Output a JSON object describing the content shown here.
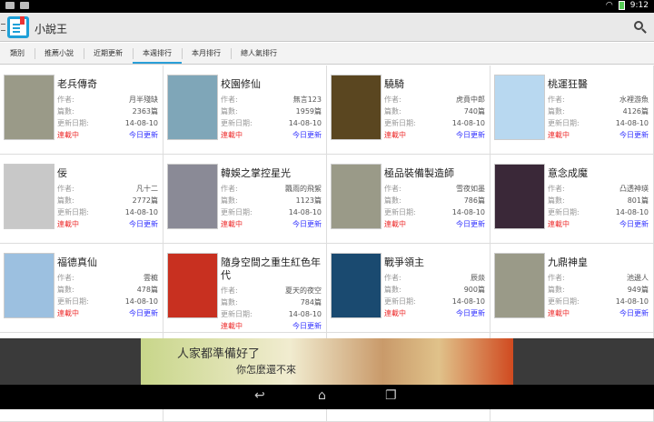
{
  "status": {
    "time": "9:12"
  },
  "app": {
    "title": "小說王"
  },
  "tabs": [
    "類別",
    "推薦小說",
    "近期更新",
    "本週排行",
    "本月排行",
    "總人氣排行"
  ],
  "labels": {
    "author": "作者:",
    "chapters": "篇數:",
    "updated": "更新日期:"
  },
  "books": [
    {
      "title": "老兵傳奇",
      "author": "月半殘缺",
      "chapters": "2363篇",
      "date": "14-08-10",
      "status": "連載中",
      "update": "今日更新",
      "cover": "#9a9a88"
    },
    {
      "title": "校園修仙",
      "author": "無言123",
      "chapters": "1959篇",
      "date": "14-08-10",
      "status": "連載中",
      "update": "今日更新",
      "cover": "#7fa6b8"
    },
    {
      "title": "驍騎",
      "author": "虎賁中郎",
      "chapters": "740篇",
      "date": "14-08-10",
      "status": "連載中",
      "update": "今日更新",
      "cover": "#5a4620"
    },
    {
      "title": "桃運狂醫",
      "author": "水裡游魚",
      "chapters": "4126篇",
      "date": "14-08-10",
      "status": "連載中",
      "update": "今日更新",
      "cover": "#b8d8f0"
    },
    {
      "title": "佞",
      "author": "凡十二",
      "chapters": "2772篇",
      "date": "14-08-10",
      "status": "連載中",
      "update": "今日更新",
      "cover": "#c8c8c8"
    },
    {
      "title": "韓娛之掌控星光",
      "author": "飄雨的飛絮",
      "chapters": "1123篇",
      "date": "14-08-10",
      "status": "連載中",
      "update": "今日更新",
      "cover": "#8a8a96"
    },
    {
      "title": "極品裝備製造師",
      "author": "雪夜如墨",
      "chapters": "786篇",
      "date": "14-08-10",
      "status": "連載中",
      "update": "今日更新",
      "cover": "#9a9a88"
    },
    {
      "title": "意念成魔",
      "author": "凸透神瑛",
      "chapters": "801篇",
      "date": "14-08-10",
      "status": "連載中",
      "update": "今日更新",
      "cover": "#3a2838"
    },
    {
      "title": "福德真仙",
      "author": "雲榳",
      "chapters": "478篇",
      "date": "14-08-10",
      "status": "連載中",
      "update": "今日更新",
      "cover": "#9cc0e0"
    },
    {
      "title": "隨身空間之重生紅色年代",
      "author": "夏天的夜空",
      "chapters": "784篇",
      "date": "14-08-10",
      "status": "連載中",
      "update": "今日更新",
      "cover": "#c83020"
    },
    {
      "title": "戰爭領主",
      "author": "辰燚",
      "chapters": "900篇",
      "date": "14-08-10",
      "status": "連載中",
      "update": "今日更新",
      "cover": "#1a4a70"
    },
    {
      "title": "九鼎神皇",
      "author": "池邊人",
      "chapters": "949篇",
      "date": "14-08-10",
      "status": "連載中",
      "update": "今日更新",
      "cover": "#9a9a88"
    }
  ],
  "ad": {
    "line1": "人家都準備好了",
    "line2": "你怎麼還不來"
  }
}
